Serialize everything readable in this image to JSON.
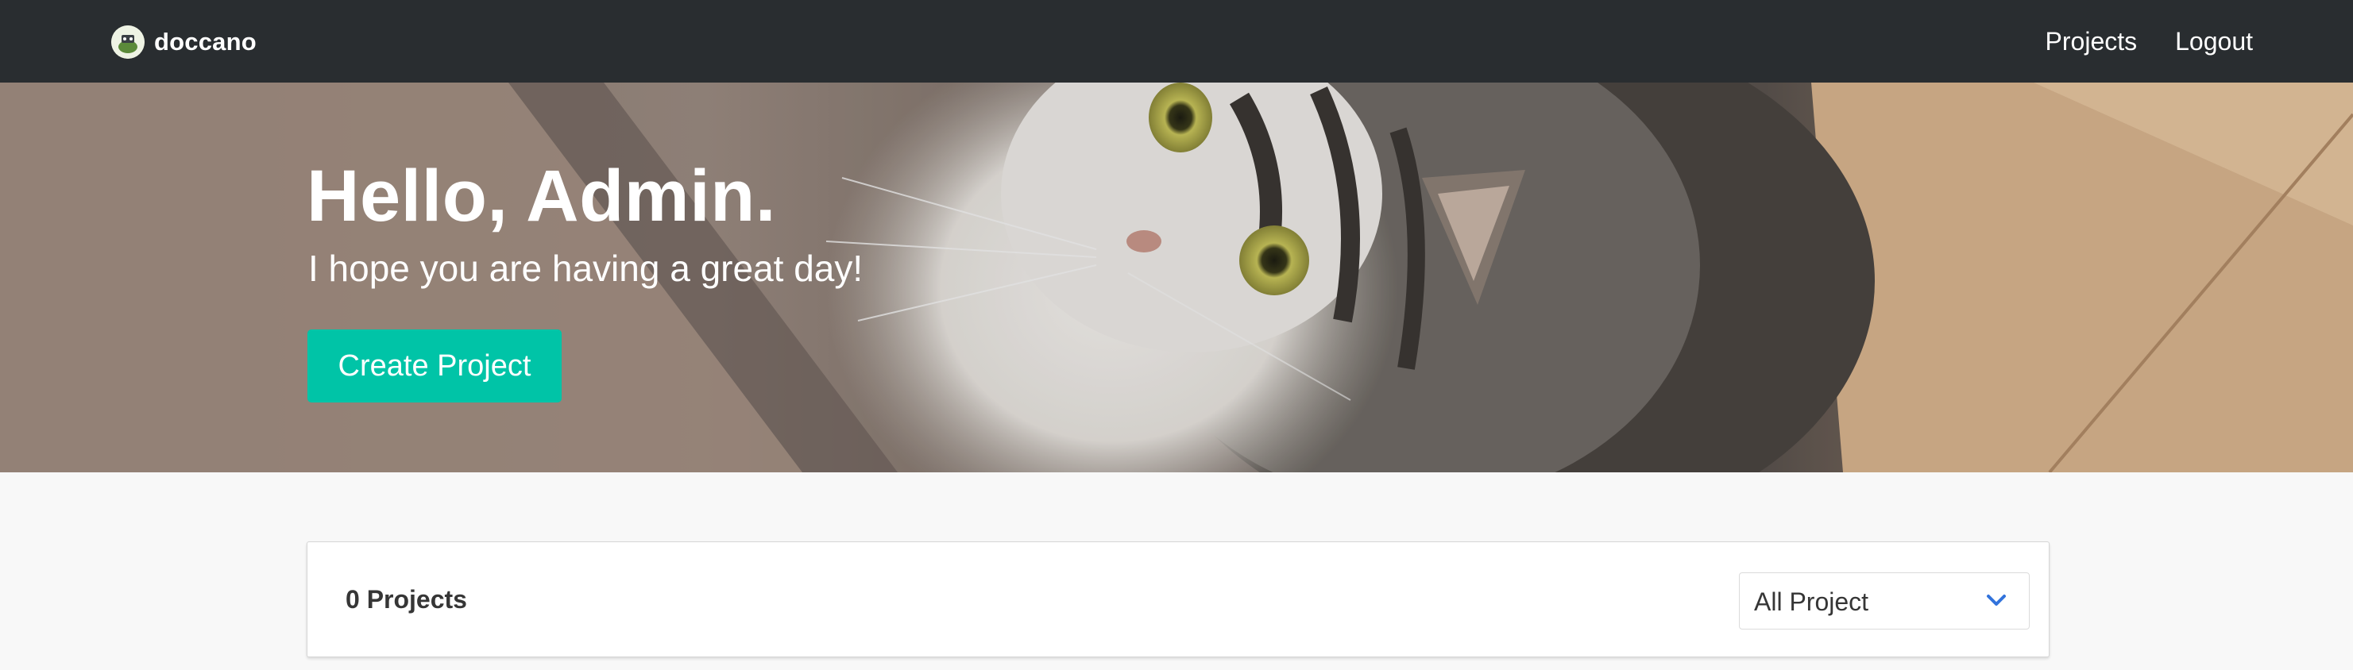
{
  "navbar": {
    "brand": "doccano",
    "links": [
      {
        "label": "Projects"
      },
      {
        "label": "Logout"
      }
    ]
  },
  "hero": {
    "title": "Hello, Admin.",
    "subtitle": "I hope you are having a great day!",
    "cta_label": "Create Project",
    "accent_color": "#00c4a7"
  },
  "projects_panel": {
    "count_label": "0 Projects",
    "filter": {
      "selected": "All Project"
    }
  },
  "icons": {
    "brand_logo": "doccano-logo-icon",
    "dropdown": "chevron-down-icon"
  },
  "colors": {
    "navbar_bg": "#292d30",
    "page_bg": "#f8f8f8",
    "chevron": "#3273dc"
  }
}
